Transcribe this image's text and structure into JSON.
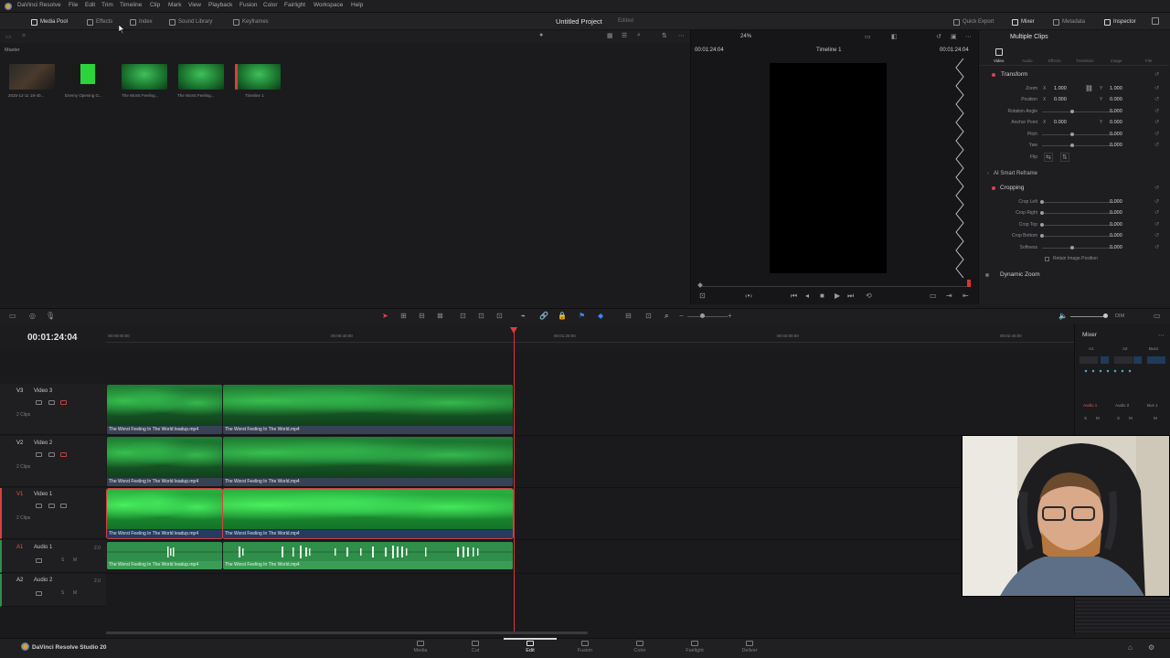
{
  "app": {
    "menu": [
      "DaVinci Resolve",
      "File",
      "Edit",
      "Trim",
      "Timeline",
      "Clip",
      "Mark",
      "View",
      "Playback",
      "Fusion",
      "Color",
      "Fairlight",
      "Workspace",
      "Help"
    ]
  },
  "toolbar": {
    "left_buttons": [
      "Media Pool",
      "Effects",
      "Index",
      "Sound Library",
      "Keyframes"
    ],
    "project_title": "Untitled Project",
    "project_status": "Edited",
    "right_buttons": [
      "Quick Export",
      "Mixer",
      "Metadata",
      "Inspector"
    ]
  },
  "media_pool": {
    "folder": "Master",
    "clips": [
      {
        "label": "2025-12-11 18-40...",
        "thumb": "dark"
      },
      {
        "label": "Enemy Opening G...",
        "thumb": "screen"
      },
      {
        "label": "The Worst Feeling...",
        "thumb": "green"
      },
      {
        "label": "The Worst Feeling...",
        "thumb": "green"
      },
      {
        "label": "Timeline 1",
        "thumb": "green"
      }
    ]
  },
  "viewer": {
    "zoom": "24%",
    "timecode_left": "00:01:24:04",
    "timeline_name": "Timeline 1",
    "timecode_right": "00:01:24:04"
  },
  "inspector": {
    "header": "Multiple Clips",
    "tabs": [
      "Video",
      "Audio",
      "Effects",
      "Transition",
      "Image",
      "File"
    ],
    "transform_title": "Transform",
    "transform_rows": [
      {
        "label": "Zoom",
        "x": "1.000",
        "y": "1.000"
      },
      {
        "label": "Position",
        "x": "0.000",
        "y": "0.000"
      },
      {
        "label": "Rotation Angle",
        "value": "0.000"
      },
      {
        "label": "Anchor Point",
        "x": "0.000",
        "y": "0.000"
      },
      {
        "label": "Pitch",
        "value": "0.000"
      },
      {
        "label": "Yaw",
        "value": "0.000"
      },
      {
        "label": "Flip",
        "value": ""
      }
    ],
    "smart_reframe": "AI Smart Reframe",
    "cropping_title": "Cropping",
    "cropping_rows": [
      {
        "label": "Crop Left",
        "value": "0.000"
      },
      {
        "label": "Crop Right",
        "value": "0.000"
      },
      {
        "label": "Crop Top",
        "value": "0.000"
      },
      {
        "label": "Crop Bottom",
        "value": "0.000"
      },
      {
        "label": "Softness",
        "value": "0.000"
      }
    ],
    "retain_label": "Retain Image Position",
    "dynamic_zoom": "Dynamic Zoom"
  },
  "timeline": {
    "timecode": "00:01:24:04",
    "ruler": [
      "00:00:00:00",
      "00:00:40:00",
      "00:01:20:00",
      "00:02:00:00",
      "00:02:40:00"
    ],
    "dim_label": "DIM",
    "tracks": [
      {
        "id": "V3",
        "name": "Video 3",
        "count": "2 Clips"
      },
      {
        "id": "V2",
        "name": "Video 2",
        "count": "2 Clips"
      },
      {
        "id": "V1",
        "name": "Video 1",
        "count": "2 Clips"
      },
      {
        "id": "A1",
        "name": "Audio 1",
        "level": "2.0"
      },
      {
        "id": "A2",
        "name": "Audio 2",
        "level": "2.0"
      }
    ],
    "clip_a": "The Worst Feeling In The World leadup.mp4",
    "clip_b": "The Worst Feeling In The World.mp4"
  },
  "mixer": {
    "title": "Mixer",
    "channels": [
      "A1",
      "A2",
      "Bus1"
    ],
    "bottom_channels": [
      "Audio 1",
      "Audio 2",
      "Bus 1"
    ]
  },
  "pages": [
    "Media",
    "Cut",
    "Edit",
    "Fusion",
    "Color",
    "Fairlight",
    "Deliver"
  ],
  "active_page": "Edit",
  "brand": "DaVinci Resolve Studio 20",
  "colors": {
    "accent": "#d74040",
    "video_clip": "#2bb540",
    "audio_clip": "#2f8f4a",
    "selection": "#e23a3a"
  }
}
